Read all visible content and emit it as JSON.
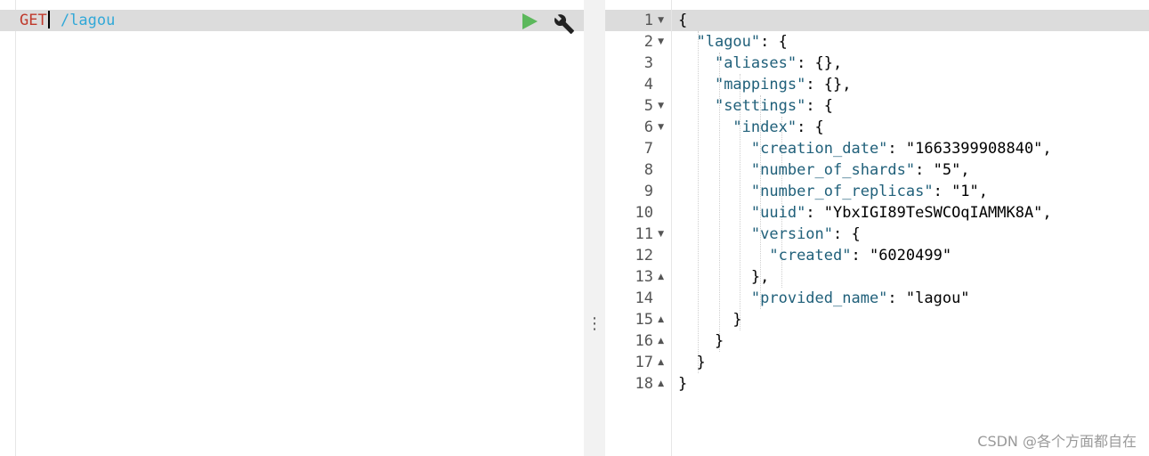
{
  "request": {
    "method": "GET",
    "path": " /lagou"
  },
  "icons": {
    "run": "play-triangle-icon",
    "settings": "wrench-icon",
    "resize": "vertical-ellipsis-icon"
  },
  "colors": {
    "method": "#c0392b",
    "path": "#31a8d8",
    "run": "#5cb85c",
    "active_line": "#dcdcdc"
  },
  "divider_label": "⋮",
  "response": {
    "lines": [
      {
        "n": "1",
        "fold": "open",
        "t": "{"
      },
      {
        "n": "2",
        "fold": "open",
        "t": "  \"lagou\": {"
      },
      {
        "n": "3",
        "fold": "",
        "t": "    \"aliases\": {},"
      },
      {
        "n": "4",
        "fold": "",
        "t": "    \"mappings\": {},"
      },
      {
        "n": "5",
        "fold": "open",
        "t": "    \"settings\": {"
      },
      {
        "n": "6",
        "fold": "open",
        "t": "      \"index\": {"
      },
      {
        "n": "7",
        "fold": "",
        "t": "        \"creation_date\": \"1663399908840\","
      },
      {
        "n": "8",
        "fold": "",
        "t": "        \"number_of_shards\": \"5\","
      },
      {
        "n": "9",
        "fold": "",
        "t": "        \"number_of_replicas\": \"1\","
      },
      {
        "n": "10",
        "fold": "",
        "t": "        \"uuid\": \"YbxIGI89TeSWCOqIAMMK8A\","
      },
      {
        "n": "11",
        "fold": "open",
        "t": "        \"version\": {"
      },
      {
        "n": "12",
        "fold": "",
        "t": "          \"created\": \"6020499\""
      },
      {
        "n": "13",
        "fold": "close",
        "t": "        },"
      },
      {
        "n": "14",
        "fold": "",
        "t": "        \"provided_name\": \"lagou\""
      },
      {
        "n": "15",
        "fold": "close",
        "t": "      }"
      },
      {
        "n": "16",
        "fold": "close",
        "t": "    }"
      },
      {
        "n": "17",
        "fold": "close",
        "t": "  }"
      },
      {
        "n": "18",
        "fold": "close",
        "t": "}"
      }
    ]
  },
  "watermark": "CSDN @各个方面都自在"
}
